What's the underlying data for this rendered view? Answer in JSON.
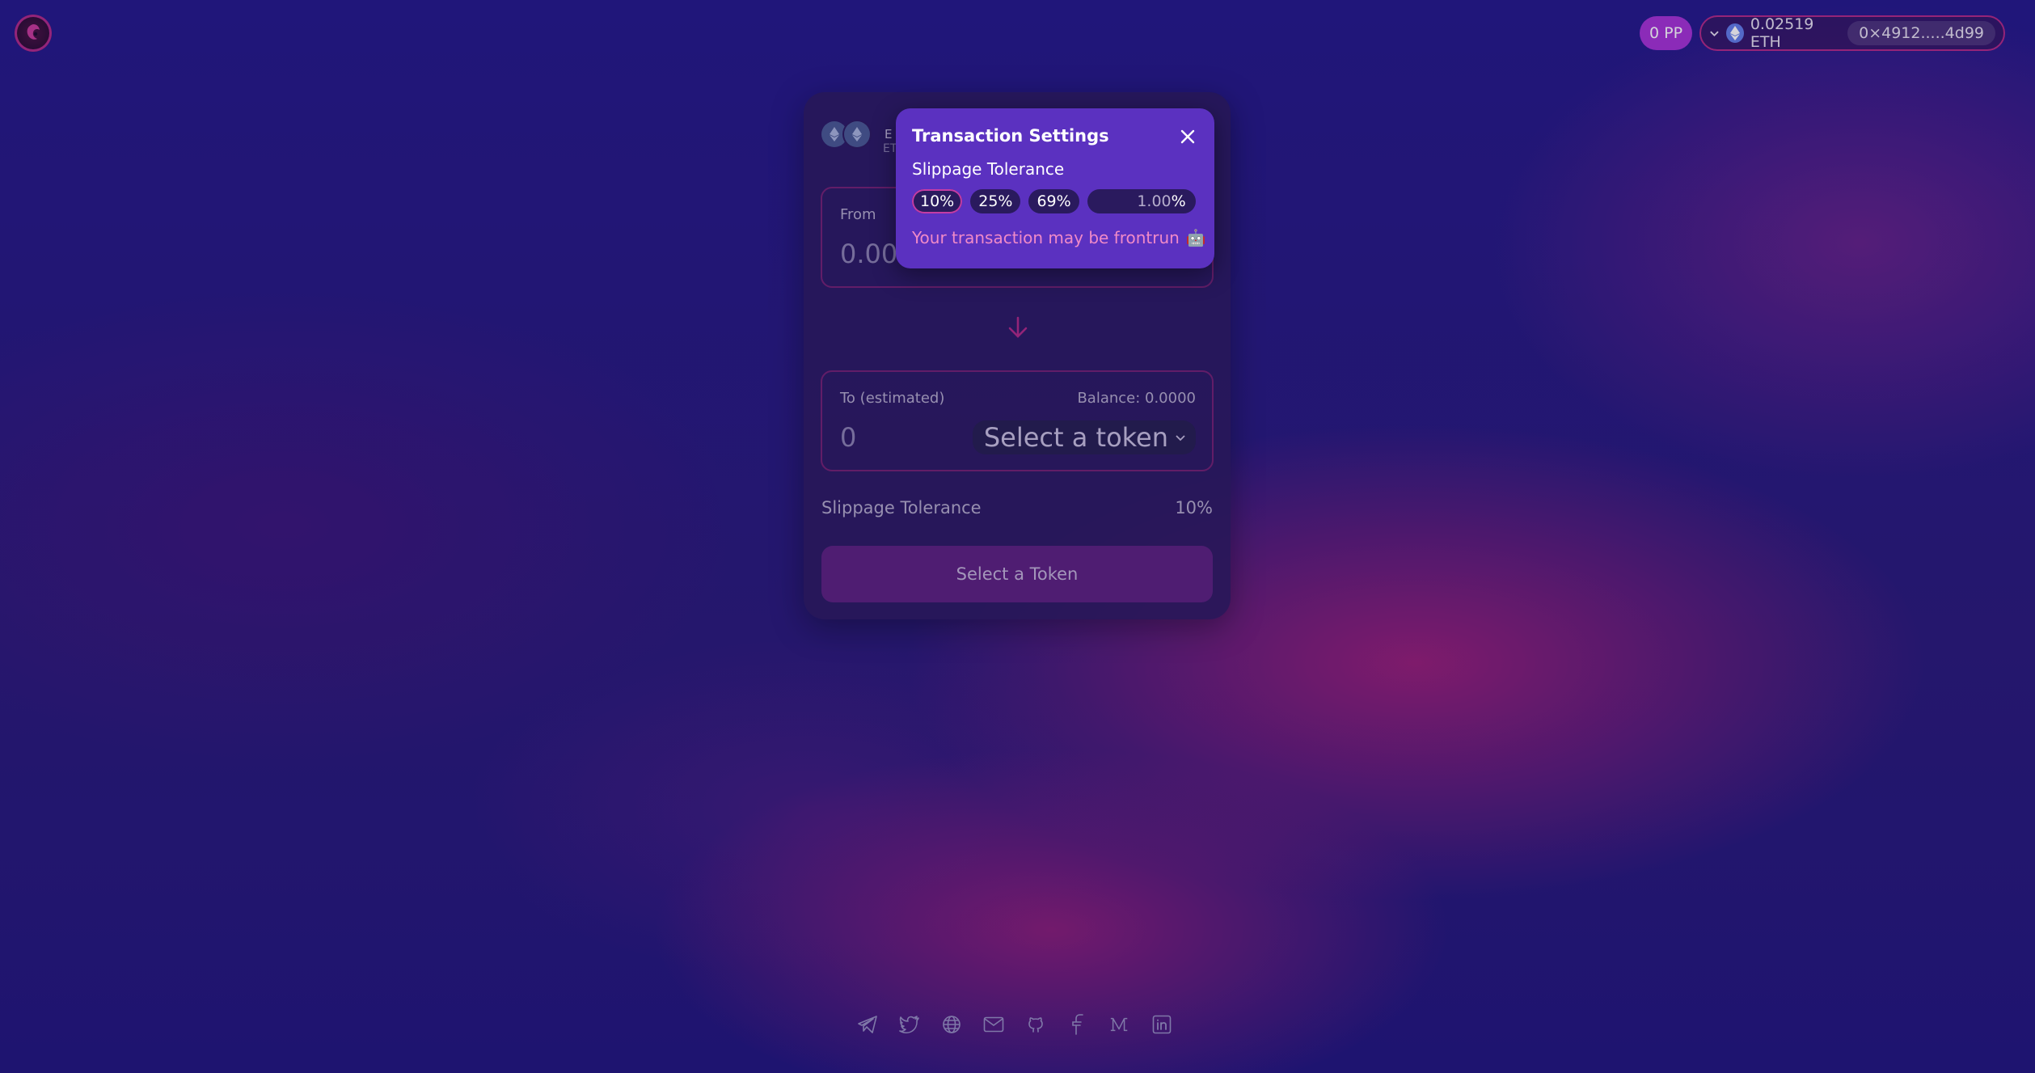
{
  "header": {
    "points_badge": "0 PP",
    "wallet": {
      "balance": "0.02519 ETH",
      "address": "0×4912.....4d99"
    }
  },
  "swap": {
    "pair_label": "E",
    "chain_label": "ET",
    "from": {
      "label": "From",
      "amount": "0.00"
    },
    "to": {
      "label": "To (estimated)",
      "balance": "Balance: 0.0000",
      "amount": "0",
      "token_select": "Select a token"
    },
    "slippage": {
      "label": "Slippage Tolerance",
      "value": "10%"
    },
    "action_button": "Select a Token"
  },
  "settings": {
    "title": "Transaction Settings",
    "subtitle": "Slippage Tolerance",
    "options": [
      "10%",
      "25%",
      "69%"
    ],
    "custom_value": "1.00",
    "custom_unit": "%",
    "warning": "Your transaction may be frontrun",
    "warning_emoji": "🤖"
  },
  "footer": {
    "icons": [
      "telegram-icon",
      "twitter-icon",
      "globe-icon",
      "mail-icon",
      "github-icon",
      "facebook-icon",
      "medium-icon",
      "linkedin-icon"
    ]
  },
  "colors": {
    "accent": "#b02a88",
    "popover": "#5b31c0",
    "points_badge": "#a632d6"
  }
}
